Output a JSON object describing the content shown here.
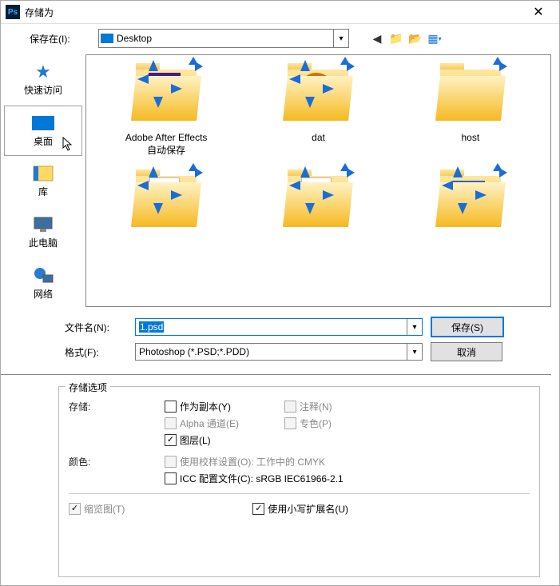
{
  "titlebar": {
    "title": "存储为"
  },
  "toolbar": {
    "save_in_label": "保存在(I):",
    "location": "Desktop"
  },
  "sidebar": {
    "items": [
      {
        "label": "快速访问"
      },
      {
        "label": "桌面"
      },
      {
        "label": "库"
      },
      {
        "label": "此电脑"
      },
      {
        "label": "网络"
      }
    ]
  },
  "files": {
    "row0": [
      {
        "label_line1": "Adobe After Effects",
        "label_line2": "自动保存"
      },
      {
        "label_line1": "dat",
        "label_line2": ""
      },
      {
        "label_line1": "host",
        "label_line2": ""
      }
    ]
  },
  "form": {
    "filename_label": "文件名(N):",
    "filename_value": "1.psd",
    "format_label": "格式(F):",
    "format_value": "Photoshop (*.PSD;*.PDD)",
    "save_btn": "保存(S)",
    "cancel_btn": "取消"
  },
  "options": {
    "legend": "存储选项",
    "storage_label": "存储:",
    "as_copy": "作为副本(Y)",
    "notes": "注释(N)",
    "alpha": "Alpha 通道(E)",
    "spot": "专色(P)",
    "layers": "图层(L)",
    "color_label": "颜色:",
    "proof": "使用校样设置(O): 工作中的 CMYK",
    "icc": "ICC 配置文件(C): sRGB IEC61966-2.1",
    "thumbnail": "缩览图(T)",
    "lowercase_ext": "使用小写扩展名(U)"
  }
}
